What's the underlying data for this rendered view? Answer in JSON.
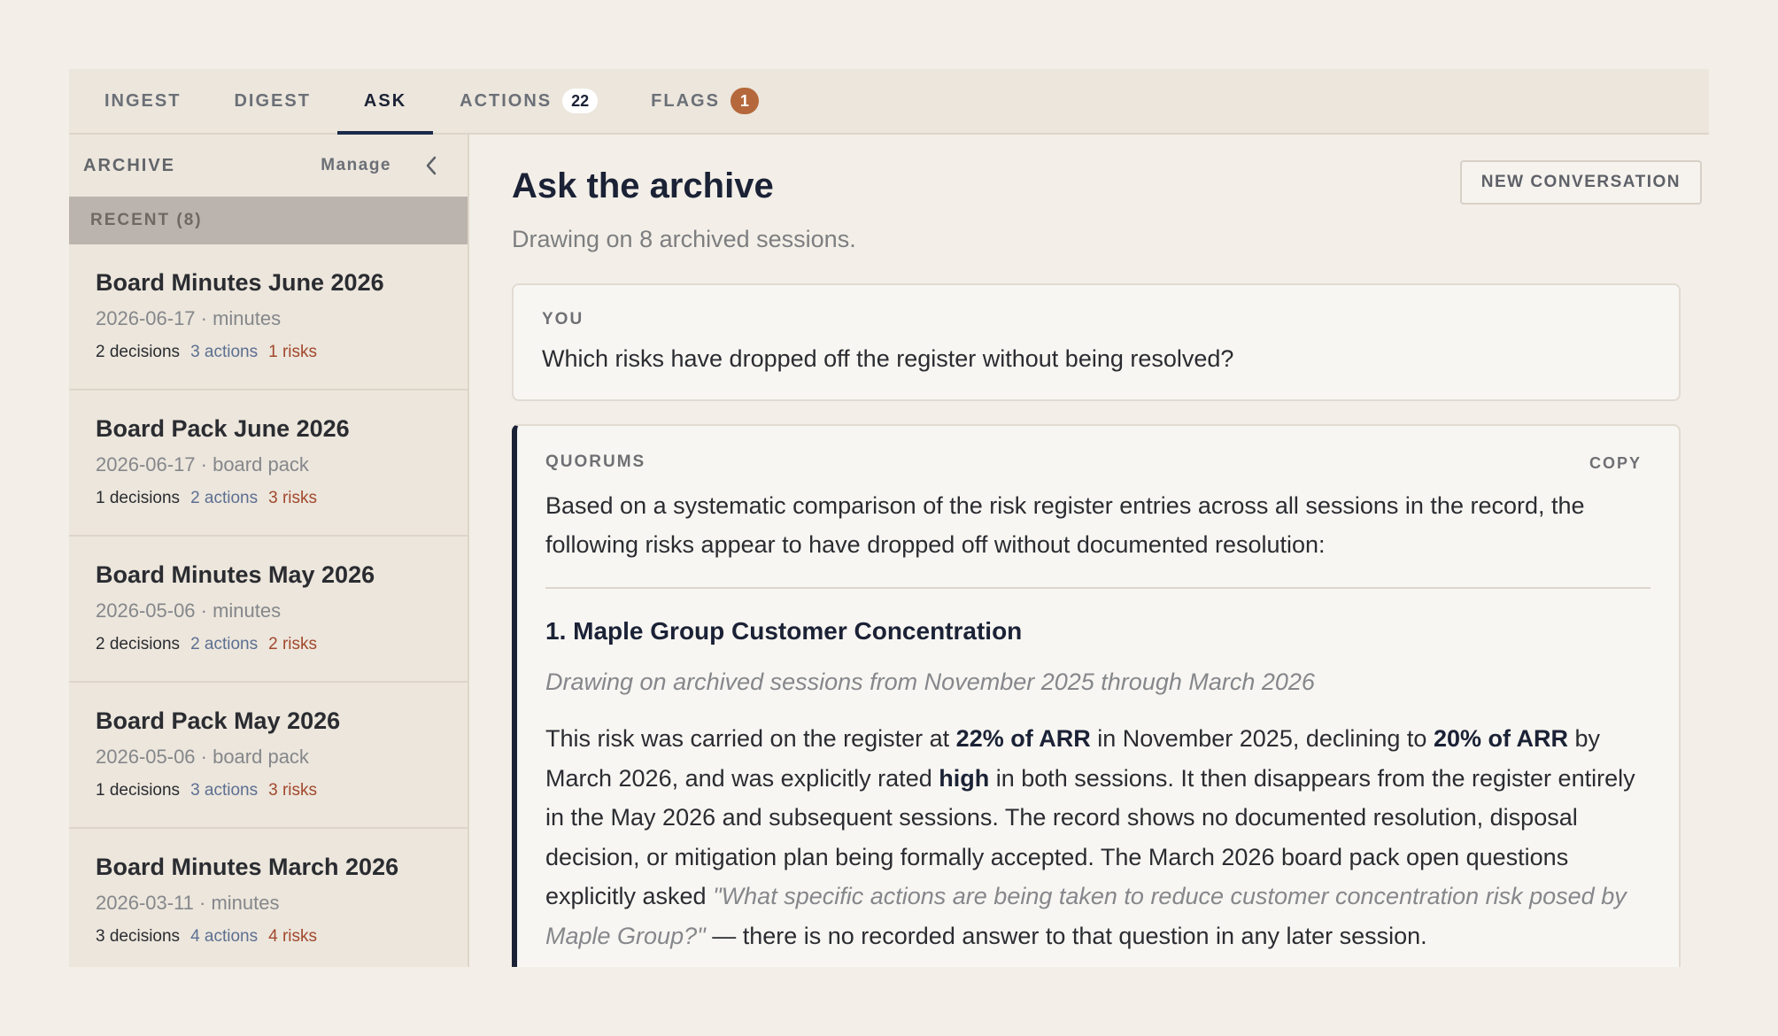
{
  "tabs": [
    {
      "label": "INGEST",
      "badge": null
    },
    {
      "label": "DIGEST",
      "badge": null
    },
    {
      "label": "ASK",
      "badge": null
    },
    {
      "label": "ACTIONS",
      "badge": "22"
    },
    {
      "label": "FLAGS",
      "badge": "1"
    }
  ],
  "active_tab": "ASK",
  "sidebar": {
    "title": "ARCHIVE",
    "manage_label": "Manage",
    "collapse_icon": "chevron-left-icon",
    "recent_label": "RECENT (8)",
    "sessions": [
      {
        "title": "Board Minutes June 2026",
        "meta": "2026-06-17 · minutes",
        "decisions": "2 decisions",
        "actions": "3 actions",
        "risks": "1 risks"
      },
      {
        "title": "Board Pack June 2026",
        "meta": "2026-06-17 · board pack",
        "decisions": "1 decisions",
        "actions": "2 actions",
        "risks": "3 risks"
      },
      {
        "title": "Board Minutes May 2026",
        "meta": "2026-05-06 · minutes",
        "decisions": "2 decisions",
        "actions": "2 actions",
        "risks": "2 risks"
      },
      {
        "title": "Board Pack May 2026",
        "meta": "2026-05-06 · board pack",
        "decisions": "1 decisions",
        "actions": "3 actions",
        "risks": "3 risks"
      },
      {
        "title": "Board Minutes March 2026",
        "meta": "2026-03-11 · minutes",
        "decisions": "3 decisions",
        "actions": "4 actions",
        "risks": "4 risks"
      }
    ]
  },
  "main": {
    "title": "Ask the archive",
    "subtitle": "Drawing on 8 archived sessions.",
    "new_conversation_label": "NEW CONVERSATION",
    "you": {
      "label": "YOU",
      "text": "Which risks have dropped off the register without being resolved?"
    },
    "answer": {
      "label": "QUORUMS",
      "copy_label": "COPY",
      "intro": "Based on a systematic comparison of the risk register entries across all sessions in the record, the following risks appear to have dropped off without documented resolution:",
      "item_heading": "1. Maple Group Customer Concentration",
      "item_source": "Drawing on archived sessions from November 2025 through March 2026",
      "p_1": "This risk was carried on the register at ",
      "p_b1": "22% of ARR",
      "p_2": " in November 2025, declining to ",
      "p_b2": "20% of ARR",
      "p_3": " by March 2026, and was explicitly rated ",
      "p_b3": "high",
      "p_4": " in both sessions. It then disappears from the register entirely in the May 2026 and subsequent sessions. The record shows no documented resolution, disposal decision, or mitigation plan being formally accepted. The March 2026 board pack open questions explicitly asked ",
      "p_quote": "\"What specific actions are being taken to reduce customer concentration risk posed by Maple Group?\"",
      "p_5": " — there is no recorded answer to that question in any later session."
    }
  },
  "colors": {
    "background": "#f3efe8",
    "navy": "#1b2236",
    "badge_orange": "#b5683c",
    "actions_blue": "#5c6f92",
    "risks_red": "#a2482d"
  }
}
